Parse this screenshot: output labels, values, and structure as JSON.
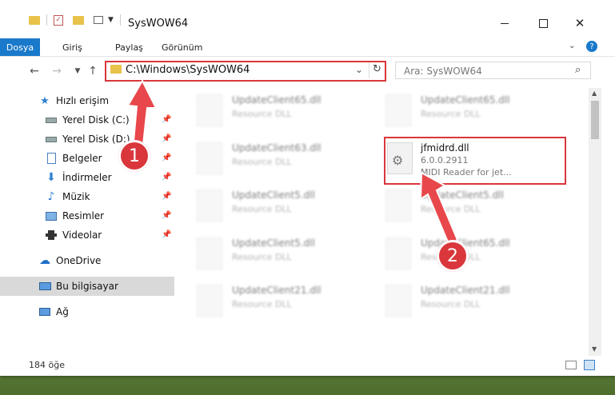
{
  "window": {
    "title": "SysWOW64"
  },
  "ribbon": {
    "tabs": [
      "Dosya",
      "Giriş",
      "Paylaş",
      "Görünüm"
    ]
  },
  "address": {
    "path": "C:\\Windows\\SysWOW64"
  },
  "search": {
    "placeholder": "Ara: SysWOW64"
  },
  "sidebar": {
    "quick_access": "Hızlı erişim",
    "items": [
      "Yerel Disk (C:)",
      "Yerel Disk (D:)",
      "Belgeler",
      "İndirmeler",
      "Müzik",
      "Resimler",
      "Videolar"
    ],
    "onedrive": "OneDrive",
    "this_pc": "Bu bilgisayar",
    "network": "Ağ"
  },
  "files": {
    "left": [
      {
        "name": "UpdateClient65.dll",
        "type": "Resource DLL"
      },
      {
        "name": "UpdateClient63.dll",
        "type": "Resource DLL"
      },
      {
        "name": "UpdateClient5.dll",
        "type": "Resource DLL"
      },
      {
        "name": "UpdateClient5.dll",
        "type": "Resource DLL"
      },
      {
        "name": "UpdateClient21.dll",
        "type": "Resource DLL"
      }
    ],
    "right": [
      {
        "name": "UpdateClient65.dll",
        "type": "Resource DLL"
      },
      {
        "name": "UpdateClient5.dll",
        "type": "Resource DLL"
      },
      {
        "name": "UpdateClient65.dll",
        "type": "Resource DLL"
      },
      {
        "name": "UpdateClient21.dll",
        "type": "Resource DLL"
      }
    ],
    "selected": {
      "name": "jfmidrd.dll",
      "version": "6.0.0.2911",
      "description": "MIDI Reader for jet..."
    }
  },
  "status": {
    "count": "184 öğe"
  },
  "callouts": [
    "1",
    "2"
  ],
  "colors": {
    "accent": "#1979ca",
    "highlight": "#d9373b"
  }
}
